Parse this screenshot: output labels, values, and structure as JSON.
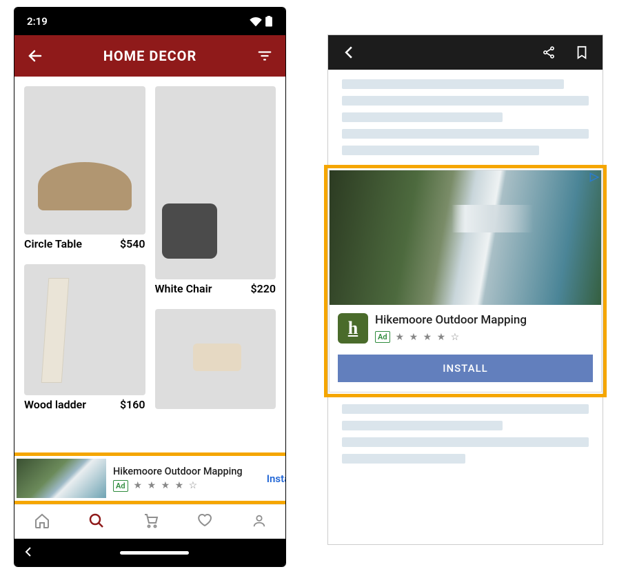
{
  "statusbar": {
    "time": "2:19"
  },
  "header": {
    "title": "HOME DECOR"
  },
  "products": {
    "left": [
      {
        "name": "Circle Table",
        "price": "$540"
      },
      {
        "name": "Wood ladder",
        "price": "$160"
      }
    ],
    "right": [
      {
        "name": "White Chair",
        "price": "$220"
      }
    ]
  },
  "banner_ad": {
    "title": "Hikemoore Outdoor Mapping",
    "badge": "Ad",
    "rating_stars": "★ ★ ★ ★ ☆",
    "action": "Install"
  },
  "big_ad": {
    "title": "Hikemoore Outdoor Mapping",
    "badge": "Ad",
    "rating_stars": "★ ★ ★ ★ ☆",
    "icon_letter": "h",
    "action": "INSTALL"
  }
}
